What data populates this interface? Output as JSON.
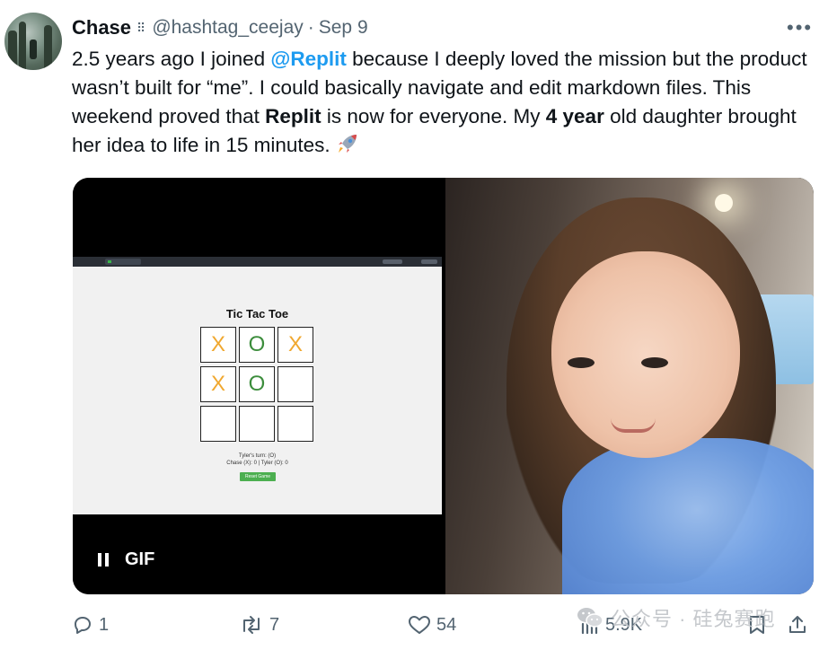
{
  "tweet": {
    "author_name": "Chase",
    "handle": "@hashtag_ceejay",
    "separator": "·",
    "date": "Sep 9",
    "text": {
      "p1": "2.5 years ago I joined ",
      "mention": "@Replit",
      "p2": " because I deeply loved the mission but the product wasn’t built for “me”. I could basically navigate and edit markdown files. This weekend proved that ",
      "bold1": "Replit",
      "p3": " is now for everyone. My ",
      "bold2": "4 year",
      "p4": " old daughter brought her idea to life in 15 minutes."
    }
  },
  "media": {
    "game": {
      "title": "Tic Tac Toe",
      "cells": [
        "X",
        "O",
        "X",
        "X",
        "O",
        "",
        "",
        "",
        ""
      ],
      "status_line1": "Tyler's turn: (O)",
      "status_line2": "Chase (X): 0 | Tyler (O): 0",
      "reset_label": "Reset Game"
    },
    "gif_label": "GIF"
  },
  "actions": {
    "replies": "1",
    "retweets": "7",
    "likes": "54",
    "views": "5.9K"
  },
  "watermark": {
    "text": "公众号 · 硅兔赛跑"
  },
  "colors": {
    "link": "#1d9bf0",
    "text": "#0f1419",
    "secondary": "#536471",
    "x_mark": "#f0a830",
    "o_mark": "#3c8d3c",
    "reset_button": "#4caf50"
  }
}
